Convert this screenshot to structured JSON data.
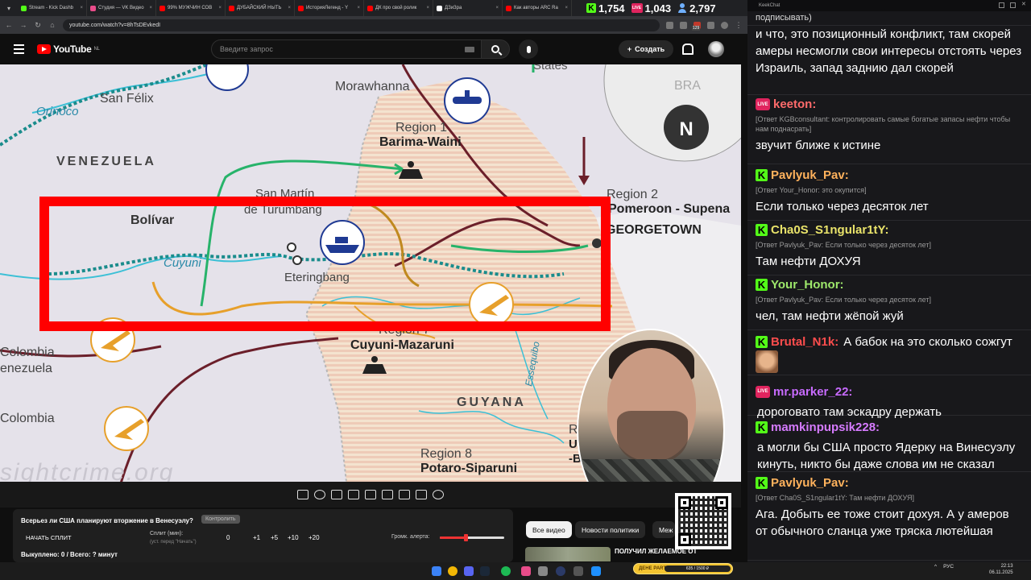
{
  "browser": {
    "tabs": [
      {
        "label": "Stream - Kick Dashb",
        "color": "#53fc18",
        "active": false
      },
      {
        "label": "Студия — VK Видео",
        "color": "#e94c8a",
        "active": false
      },
      {
        "label": "99% МУЖЧИН СОВ",
        "color": "#ff0000",
        "active": false
      },
      {
        "label": "ДУБАЙСКИЙ НЫТЬ",
        "color": "#ff0000",
        "active": false
      },
      {
        "label": "ИсторияЛегенд - Y",
        "color": "#ff0000",
        "active": false
      },
      {
        "label": "ДК про свой ролик",
        "color": "#ff0000",
        "active": false
      },
      {
        "label": "ДЗиЗра",
        "color": "#ffffff",
        "active": false
      },
      {
        "label": "Как авторы ARC Ra",
        "color": "#ff0000",
        "active": false
      }
    ],
    "url": "youtube.com/watch?v=8hTsDEvkedI",
    "badge_count": "129"
  },
  "stream_stats": {
    "kick_viewers": "1,754",
    "vk_viewers": "1,043",
    "total_viewers": "2,797"
  },
  "youtube": {
    "logo": "YouTube",
    "region": "NL",
    "search_placeholder": "Введите запрос",
    "create_label": "Создать"
  },
  "map": {
    "labels": {
      "states": "States",
      "morawhanna": "Morawhanna",
      "san_felix": "San Félix",
      "orinoco": "Orinoco",
      "bra": "BRA",
      "north": "N",
      "region1_num": "Region 1",
      "region1_name": "Barima-Waini",
      "venezuela": "VENEZUELA",
      "san_martin_1": "San Martín",
      "san_martin_2": "de Turumbang",
      "region2_num": "Region 2",
      "region2_name": "Pomeroon - Supena",
      "georgetown": "GEORGETOWN",
      "bolivar": "Bolívar",
      "cuyuni": "Cuyuni",
      "eteringbang": "Eteringbang",
      "region7_num": "Region 7",
      "region7_name": "Cuyuni-Mazaruni",
      "colombia_venezuela_1": "Colombia",
      "colombia_venezuela_2": "enezuela",
      "colombia": "Colombia",
      "guyana": "GUYANA",
      "essequibo": "Essequibo",
      "region10_1": "Regi",
      "region10_2": "Uppe",
      "region10_3": "-Berbice",
      "region8_num": "Region 8",
      "region8_name": "Potaro-Siparuni",
      "watermark": "sightcrime.org"
    }
  },
  "poll": {
    "question": "Всерьез ли США планируют вторжение в Венесуэлу?",
    "tag": "Контролить",
    "split_button": "НАЧАТЬ СПЛИТ",
    "split_label": "Сплит (мин):",
    "split_hint": "(уст. перед \"Начать\")",
    "split_value": "0",
    "increments": [
      "+1",
      "+5",
      "+10",
      "+20"
    ],
    "alert_label": "Громк. алерта:",
    "alert_volume": 0.4,
    "votes": "Выкуплено: 0 / Всего: ? минут"
  },
  "recs": {
    "chips": [
      "Все видео",
      "Новости политики",
      "Меж"
    ],
    "first_title": "ПОЛУЧИЛ ЖЕЛАЕМОЕ ОТ"
  },
  "goal": {
    "label": "ДЕНЕ PARTY",
    "progress": "635 / 1500 ₽"
  },
  "tray": {
    "lang": "РУС",
    "time": "22:13",
    "date": "06.11.2025"
  },
  "chat": {
    "app_title": "KeekChat",
    "messages": [
      {
        "platform": "none",
        "user": "",
        "user_color": "#ffffff",
        "reply": "",
        "text": "подписывать)"
      },
      {
        "platform": "none",
        "user": "",
        "user_color": "#ffffff",
        "reply": "",
        "text": "и что, это позиционный конфликт, там скорей амеры несмогли свои интересы отстоять через Израиль, запад заднию дал скорей"
      },
      {
        "platform": "vk",
        "user": "keeton:",
        "user_color": "#ff6b6b",
        "reply": "[Ответ KGBconsultant: контролировать самые богатые запасы нефти чтобы нам поднасрать]",
        "text": "звучит ближе к истине"
      },
      {
        "platform": "kick",
        "user": "Pavlyuk_Pav:",
        "user_color": "#ffb25c",
        "reply": "[Ответ Your_Honor: это окупится]",
        "text": "Если только через десяток лет"
      },
      {
        "platform": "kick",
        "user": "Cha0S_S1ngular1tY:",
        "user_color": "#e9e36a",
        "reply": "[Ответ Pavlyuk_Pav: Если только через десяток лет]",
        "text": "Там нефти ДОХУЯ"
      },
      {
        "platform": "kick",
        "user": "Your_Honor:",
        "user_color": "#9ee86b",
        "reply": "[Ответ Pavlyuk_Pav: Если только через десяток лет]",
        "text": "чел, там нефти жёпой жуй"
      },
      {
        "platform": "kick",
        "user": "Brutal_N1k:",
        "user_color": "#ff4d4d",
        "reply": "",
        "text": "А бабок на это сколько сожгут"
      },
      {
        "platform": "vk",
        "user": "mr.parker_22:",
        "user_color": "#c86bff",
        "reply": "",
        "text": "дороговато там эскадру держать"
      },
      {
        "platform": "kick",
        "user": "mamkinpupsik228:",
        "user_color": "#d67bff",
        "reply": "",
        "text": "а могли бы США просто Ядерку на Винесуэлу кинуть, никто бы даже слова им не сказал"
      },
      {
        "platform": "kick",
        "user": "Pavlyuk_Pav:",
        "user_color": "#ffb25c",
        "reply": "[Ответ Cha0S_S1ngular1tY: Там нефти ДОХУЯ]",
        "text": "Ага. Добыть ее тоже стоит дохуя. А у амеров от обычного сланца уже тряска лютейшая"
      }
    ]
  }
}
